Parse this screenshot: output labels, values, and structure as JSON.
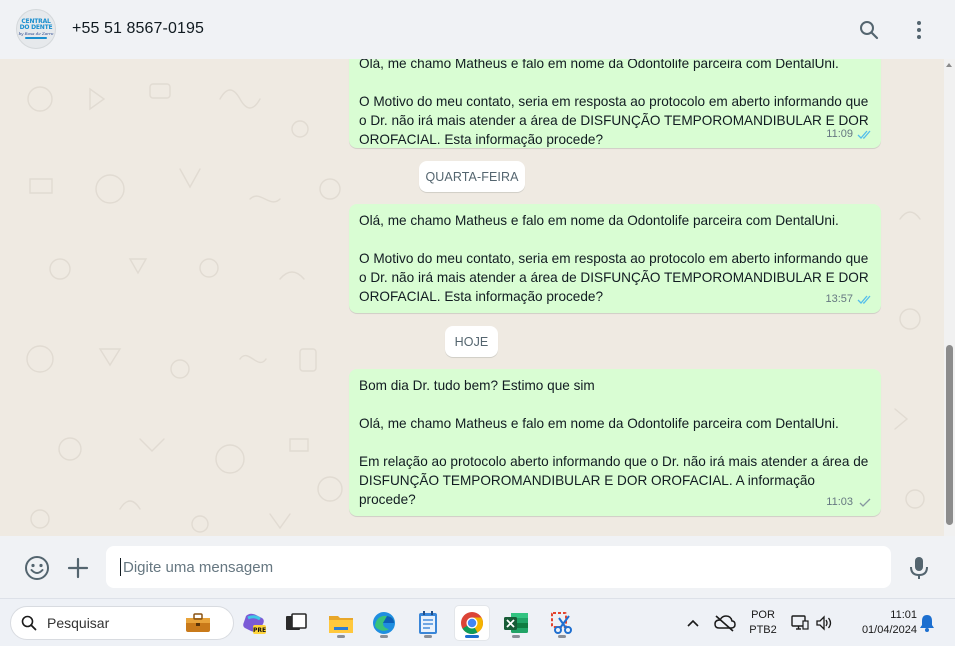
{
  "header": {
    "contact_name": "+55 51 8567-0195",
    "avatar": {
      "line1": "CENTRAL",
      "line2": "DO DENTE",
      "line3": "by Rosa de Zarro"
    },
    "icons": {
      "search": "search-icon",
      "menu": "kebab-menu-icon"
    }
  },
  "messages": [
    {
      "clipped_first_line": "Olá, me chamo Matheus e falo em nome da Odontolife parceira com DentalUni.",
      "lines": [
        "",
        "O Motivo do meu contato, seria em resposta ao protocolo em aberto informando que o Dr. não irá mais atender a área de DISFUNÇÃO TEMPOROMANDIBULAR E DOR OROFACIAL. Esta informação procede?"
      ],
      "time": "11:09",
      "status": "read"
    },
    {
      "lines": [
        "Olá, me chamo Matheus e falo em nome da Odontolife parceira com DentalUni.",
        "",
        "O Motivo do meu contato, seria em resposta ao protocolo em aberto informando que o Dr. não irá mais atender a área de DISFUNÇÃO TEMPOROMANDIBULAR E DOR OROFACIAL. Esta informação procede?"
      ],
      "time": "13:57",
      "status": "read"
    },
    {
      "lines": [
        "Bom dia Dr. tudo bem? Estimo que sim",
        "",
        "Olá, me chamo Matheus e falo em nome da Odontolife parceira com DentalUni.",
        "",
        "Em relação ao protocolo aberto informando que o Dr. não irá mais atender a área de DISFUNÇÃO TEMPOROMANDIBULAR E DOR OROFACIAL. A informação procede?"
      ],
      "time": "11:03",
      "status": "sent"
    }
  ],
  "day_separators": [
    "QUARTA-FEIRA",
    "HOJE"
  ],
  "composer": {
    "placeholder": "Digite uma mensagem",
    "icons": {
      "emoji": "emoji-icon",
      "attach": "plus-icon",
      "mic": "microphone-icon"
    }
  },
  "taskbar": {
    "search_label": "Pesquisar",
    "apps": [
      "work-briefcase",
      "copilot-pre",
      "task-view",
      "file-explorer",
      "edge",
      "notepad",
      "chrome",
      "excel",
      "snipping-tool"
    ],
    "active_app": "chrome",
    "language": "POR",
    "layout": "PTB2",
    "time": "11:01",
    "date": "01/04/2024"
  },
  "colors": {
    "outgoing_bubble": "#d9fdd3",
    "chat_background": "#efeae2",
    "header_background": "#f0f2f5",
    "read_ticks": "#53bdeb",
    "text_primary": "#111b21",
    "text_secondary": "#667781"
  }
}
